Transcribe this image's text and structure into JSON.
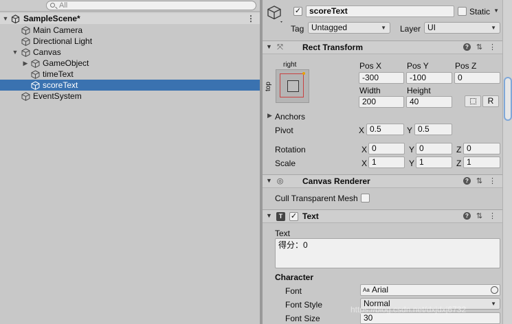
{
  "hierarchy": {
    "search_placeholder": "All",
    "scene_name": "SampleScene*",
    "items": [
      {
        "label": "Main Camera"
      },
      {
        "label": "Directional Light"
      },
      {
        "label": "Canvas"
      },
      {
        "label": "GameObject"
      },
      {
        "label": "timeText"
      },
      {
        "label": "scoreText"
      },
      {
        "label": "EventSystem"
      }
    ],
    "selected": "scoreText"
  },
  "inspector": {
    "object_name": "scoreText",
    "static_label": "Static",
    "tag_label": "Tag",
    "tag_value": "Untagged",
    "layer_label": "Layer",
    "layer_value": "UI",
    "rect_transform": {
      "title": "Rect Transform",
      "anchor_preset_h": "right",
      "anchor_preset_v": "top",
      "posx_label": "Pos X",
      "posx": "-300",
      "posy_label": "Pos Y",
      "posy": "-100",
      "posz_label": "Pos Z",
      "posz": "0",
      "width_label": "Width",
      "width": "200",
      "height_label": "Height",
      "height": "40",
      "raw_edit_label": "R",
      "anchors_label": "Anchors",
      "pivot_label": "Pivot",
      "pivot_x": "0.5",
      "pivot_y": "0.5",
      "rotation_label": "Rotation",
      "rot_x": "0",
      "rot_y": "0",
      "rot_z": "0",
      "scale_label": "Scale",
      "scale_x": "1",
      "scale_y": "1",
      "scale_z": "1",
      "x": "X",
      "y": "Y",
      "z": "Z"
    },
    "canvas_renderer": {
      "title": "Canvas Renderer",
      "cull_label": "Cull Transparent Mesh"
    },
    "text": {
      "title": "Text",
      "text_label": "Text",
      "text_value": "得分：0",
      "character_label": "Character",
      "font_label": "Font",
      "font_value": "Arial",
      "font_style_label": "Font Style",
      "font_style_value": "Normal",
      "font_size_label": "Font Size",
      "font_size_value": "30"
    }
  },
  "watermark": "https://blog.csdn.net/dxjdxj6732",
  "colors": {
    "selection": "#3a72b0",
    "scrollbar_thumb": "#7fa7d8"
  }
}
